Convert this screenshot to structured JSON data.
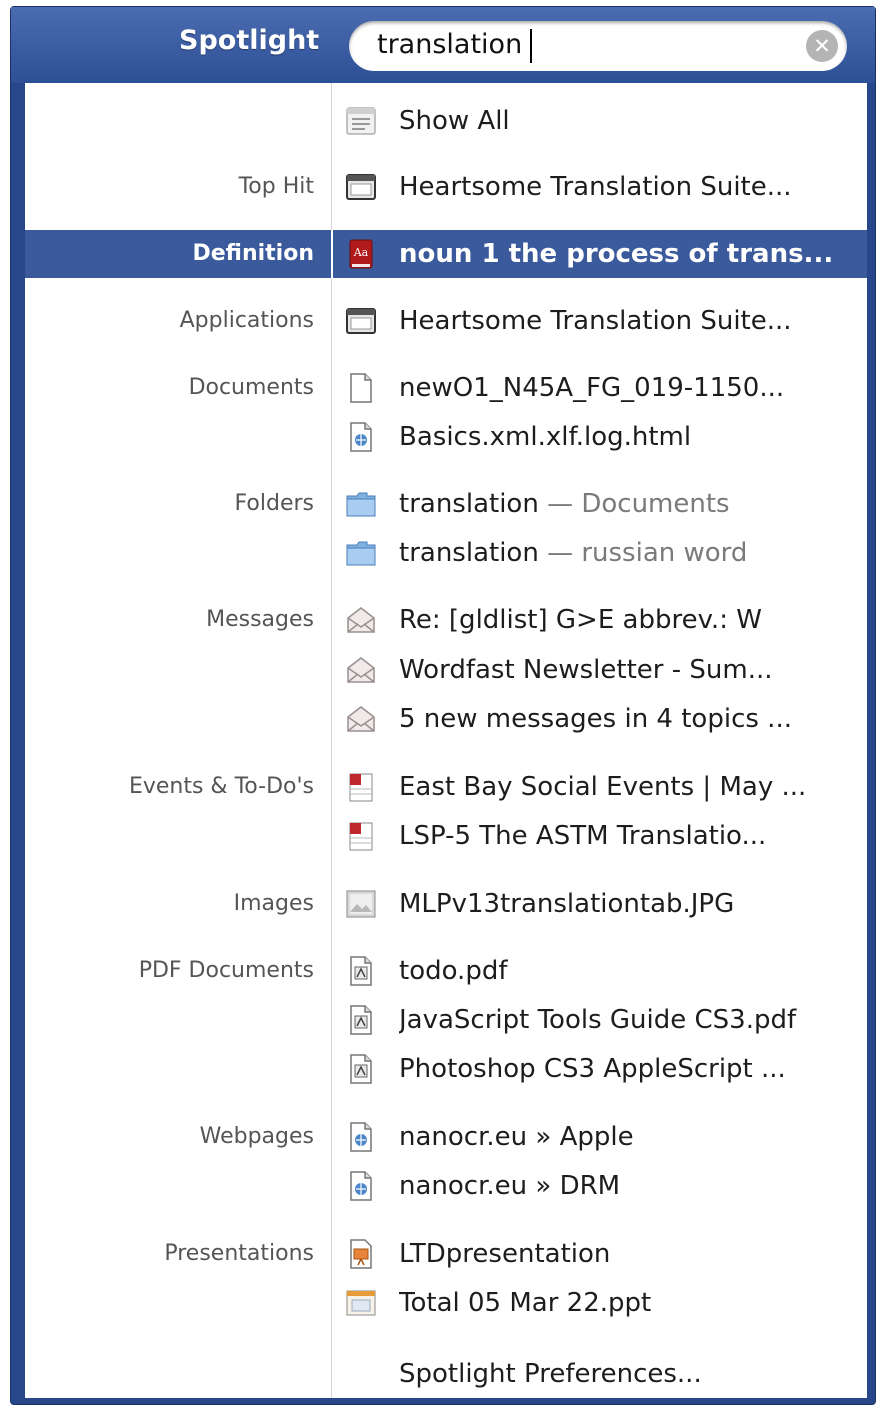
{
  "search": {
    "title": "Spotlight",
    "query": "translation",
    "clear_glyph": "✕"
  },
  "colors": {
    "header": "#2d4f96",
    "selection": "#3b5a9c",
    "category_text": "#555555"
  },
  "rows": [
    {
      "category": "",
      "name": "Show All",
      "icon": "show-all-icon"
    },
    {
      "category": "Top Hit",
      "name": "Heartsome Translation Suite...",
      "icon": "application-icon"
    },
    {
      "category": "Definition",
      "name": "noun  1 the process of trans...",
      "icon": "dictionary-icon",
      "selected": true
    },
    {
      "category": "Applications",
      "name": "Heartsome Translation Suite...",
      "icon": "application-icon"
    },
    {
      "category": "Documents",
      "name": "newO1_N45A_FG_019-1150...",
      "icon": "document-icon"
    },
    {
      "category": "",
      "name": "Basics.xml.xlf.log.html",
      "icon": "html-document-icon"
    },
    {
      "category": "Folders",
      "name": "translation",
      "sub": " — Documents",
      "icon": "folder-icon"
    },
    {
      "category": "",
      "name": "translation",
      "sub": " — russian word",
      "icon": "folder-icon"
    },
    {
      "category": "Messages",
      "name": "Re: [gldlist] G>E abbrev.: W",
      "icon": "mail-icon"
    },
    {
      "category": "",
      "name": "Wordfast Newsletter - Sum...",
      "icon": "mail-icon"
    },
    {
      "category": "",
      "name": "5 new messages in 4 topics ...",
      "icon": "mail-icon"
    },
    {
      "category": "Events & To-Do's",
      "name": "East Bay Social Events | May ...",
      "icon": "calendar-icon"
    },
    {
      "category": "",
      "name": " LSP-5 The ASTM Translatio...",
      "icon": "calendar-icon"
    },
    {
      "category": "Images",
      "name": "MLPv13translationtab.JPG",
      "icon": "image-icon"
    },
    {
      "category": "PDF Documents",
      "name": "todo.pdf",
      "icon": "pdf-icon"
    },
    {
      "category": "",
      "name": "JavaScript Tools Guide CS3.pdf",
      "icon": "pdf-icon"
    },
    {
      "category": "",
      "name": "Photoshop CS3 AppleScript ...",
      "icon": "pdf-icon"
    },
    {
      "category": "Webpages",
      "name": "nanocr.eu » Apple",
      "icon": "webpage-icon"
    },
    {
      "category": "",
      "name": "nanocr.eu » DRM",
      "icon": "webpage-icon"
    },
    {
      "category": "Presentations",
      "name": "LTDpresentation",
      "icon": "presentation-icon"
    },
    {
      "category": "",
      "name": "Total 05 Mar 22.ppt",
      "icon": "slides-icon"
    },
    {
      "category": "",
      "name": "Spotlight Preferences...",
      "icon": ""
    }
  ]
}
